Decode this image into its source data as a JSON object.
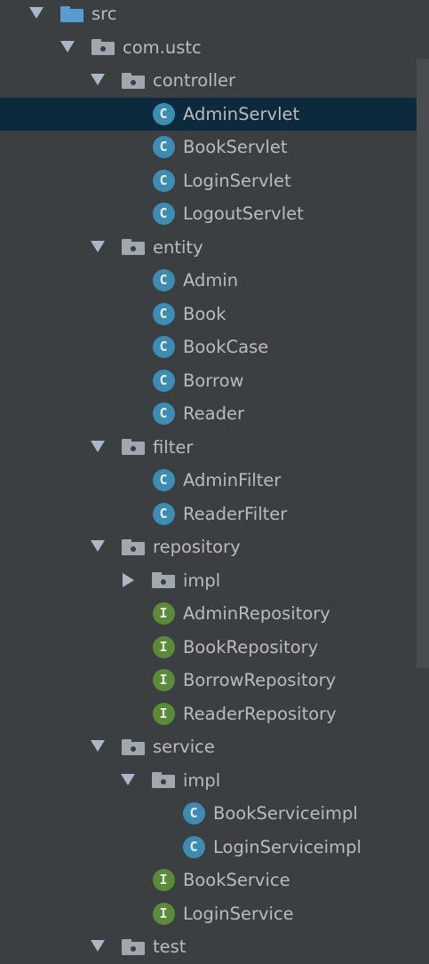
{
  "project_tree": {
    "rows": [
      {
        "label": "src",
        "depth": 0,
        "expanded": true,
        "icon": "folder-blue-icon",
        "kind": "source-root"
      },
      {
        "label": "com.ustc",
        "depth": 1,
        "expanded": true,
        "icon": "package-folder-icon",
        "kind": "package"
      },
      {
        "label": "controller",
        "depth": 2,
        "expanded": true,
        "icon": "package-folder-icon",
        "kind": "package"
      },
      {
        "label": "AdminServlet",
        "depth": 3,
        "icon": "class-icon",
        "badge": "C",
        "kind": "class",
        "selected": true
      },
      {
        "label": "BookServlet",
        "depth": 3,
        "icon": "class-icon",
        "badge": "C",
        "kind": "class"
      },
      {
        "label": "LoginServlet",
        "depth": 3,
        "icon": "class-icon",
        "badge": "C",
        "kind": "class"
      },
      {
        "label": "LogoutServlet",
        "depth": 3,
        "icon": "class-icon",
        "badge": "C",
        "kind": "class"
      },
      {
        "label": "entity",
        "depth": 2,
        "expanded": true,
        "icon": "package-folder-icon",
        "kind": "package"
      },
      {
        "label": "Admin",
        "depth": 3,
        "icon": "class-icon",
        "badge": "C",
        "kind": "class"
      },
      {
        "label": "Book",
        "depth": 3,
        "icon": "class-icon",
        "badge": "C",
        "kind": "class"
      },
      {
        "label": "BookCase",
        "depth": 3,
        "icon": "class-icon",
        "badge": "C",
        "kind": "class"
      },
      {
        "label": "Borrow",
        "depth": 3,
        "icon": "class-icon",
        "badge": "C",
        "kind": "class"
      },
      {
        "label": "Reader",
        "depth": 3,
        "icon": "class-icon",
        "badge": "C",
        "kind": "class"
      },
      {
        "label": "filter",
        "depth": 2,
        "expanded": true,
        "icon": "package-folder-icon",
        "kind": "package"
      },
      {
        "label": "AdminFilter",
        "depth": 3,
        "icon": "class-icon",
        "badge": "C",
        "kind": "class"
      },
      {
        "label": "ReaderFilter",
        "depth": 3,
        "icon": "class-icon",
        "badge": "C",
        "kind": "class"
      },
      {
        "label": "repository",
        "depth": 2,
        "expanded": true,
        "icon": "package-folder-icon",
        "kind": "package"
      },
      {
        "label": "impl",
        "depth": 3,
        "expanded": false,
        "icon": "package-folder-icon",
        "kind": "package"
      },
      {
        "label": "AdminRepository",
        "depth": 3,
        "icon": "interface-icon",
        "badge": "I",
        "kind": "interface"
      },
      {
        "label": "BookRepository",
        "depth": 3,
        "icon": "interface-icon",
        "badge": "I",
        "kind": "interface"
      },
      {
        "label": "BorrowRepository",
        "depth": 3,
        "icon": "interface-icon",
        "badge": "I",
        "kind": "interface"
      },
      {
        "label": "ReaderRepository",
        "depth": 3,
        "icon": "interface-icon",
        "badge": "I",
        "kind": "interface"
      },
      {
        "label": "service",
        "depth": 2,
        "expanded": true,
        "icon": "package-folder-icon",
        "kind": "package"
      },
      {
        "label": "impl",
        "depth": 3,
        "expanded": true,
        "icon": "package-folder-icon",
        "kind": "package"
      },
      {
        "label": "BookServiceimpl",
        "depth": 4,
        "icon": "class-icon",
        "badge": "C",
        "kind": "class"
      },
      {
        "label": "LoginServiceimpl",
        "depth": 4,
        "icon": "class-icon",
        "badge": "C",
        "kind": "class"
      },
      {
        "label": "BookService",
        "depth": 3,
        "icon": "interface-icon",
        "badge": "I",
        "kind": "interface"
      },
      {
        "label": "LoginService",
        "depth": 3,
        "icon": "interface-icon",
        "badge": "I",
        "kind": "interface"
      },
      {
        "label": "test",
        "depth": 2,
        "expanded": true,
        "icon": "package-folder-icon",
        "kind": "package"
      }
    ]
  },
  "colors": {
    "background": "#3c3f41",
    "selection": "#0d293e",
    "text": "#bbbbbb",
    "class_badge": "#3f8cb3",
    "interface_badge": "#5c8a3a",
    "folder": "#a0a7ae",
    "source_folder": "#5a9ad0"
  }
}
